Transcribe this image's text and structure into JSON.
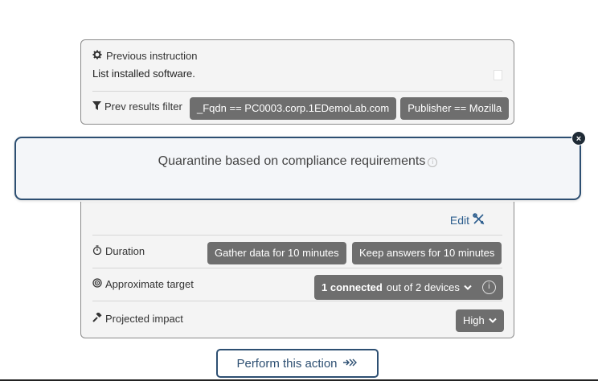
{
  "previous": {
    "heading": "Previous instruction",
    "instruction": "List installed software.",
    "filter_label": "Prev results filter",
    "filters": [
      "_Fqdn == PC0003.corp.1EDemoLab.com",
      "Publisher == Mozilla"
    ]
  },
  "quarantine": {
    "title": "Quarantine based on compliance requirements",
    "close_label": "×"
  },
  "details": {
    "edit_label": "Edit",
    "duration_label": "Duration",
    "gather_label": "Gather data for 10 minutes",
    "keep_label": "Keep answers for 10 minutes",
    "target_label": "Approximate target",
    "target_connected": "1 connected",
    "target_rest": "out of 2 devices",
    "impact_label": "Projected impact",
    "impact_value": "High"
  },
  "action": {
    "perform_label": "Perform this action"
  },
  "icons": [
    "gear-icon",
    "document-icon",
    "filter-icon",
    "info-icon",
    "close-icon",
    "edit-icon",
    "stopwatch-icon",
    "target-icon",
    "gavel-icon",
    "chevron-down-icon",
    "arrows-right-icon"
  ]
}
